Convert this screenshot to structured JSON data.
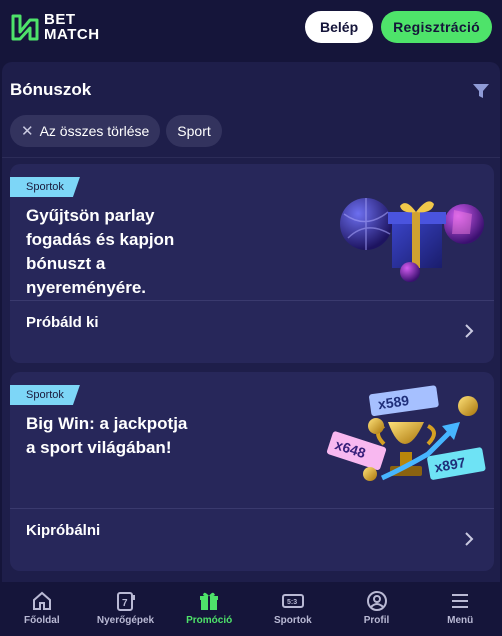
{
  "header": {
    "logo_line1": "BET",
    "logo_line2": "MATCH",
    "login_label": "Belép",
    "register_label": "Regisztráció"
  },
  "filters": {
    "title": "Bónuszok",
    "clear_all_label": "Az összes törlése",
    "active_chip": "Sport"
  },
  "promos": [
    {
      "badge": "Sportok",
      "title_lines": [
        "Gyűjtsön parlay",
        "fogadás és kapjon",
        "bónuszt a",
        "nyereményére."
      ],
      "cta": "Próbáld ki"
    },
    {
      "badge": "Sportok",
      "title_lines": [
        "Big Win: a jackpotja",
        "a sport világában!"
      ],
      "cta": "Kipróbálni",
      "art_tickets": [
        "x589",
        "x648",
        "x897"
      ]
    }
  ],
  "bottom_nav": [
    {
      "label": "Főoldal",
      "icon": "home-icon"
    },
    {
      "label": "Nyerőgépek",
      "icon": "slot-machine-icon"
    },
    {
      "label": "Promóció",
      "icon": "gift-icon",
      "active": true
    },
    {
      "label": "Sportok",
      "icon": "scoreboard-icon",
      "score": "5:3"
    },
    {
      "label": "Profil",
      "icon": "profile-icon"
    },
    {
      "label": "Menü",
      "icon": "menu-icon"
    }
  ],
  "colors": {
    "background": "#15153a",
    "panel": "#1e1e4a",
    "card": "#27275a",
    "accent_green": "#4ee36a",
    "badge": "#7dd6f7"
  }
}
